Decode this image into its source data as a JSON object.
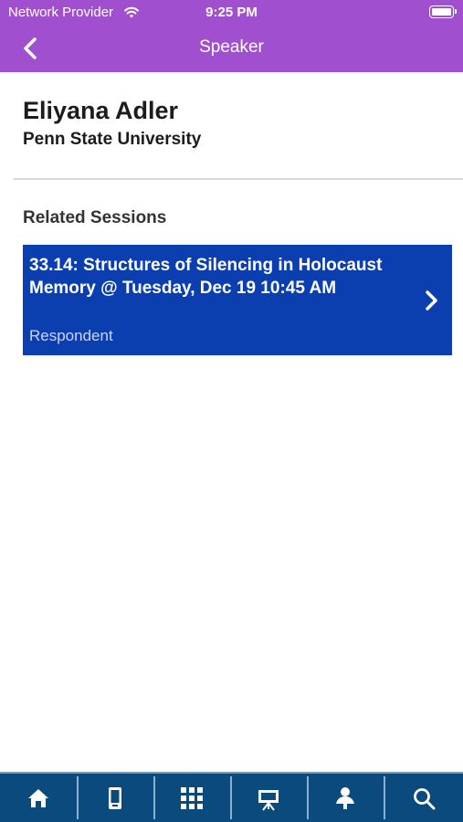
{
  "status_bar": {
    "carrier": "Network Provider",
    "time": "9:25 PM"
  },
  "header": {
    "title": "Speaker",
    "back_icon": "chevron-left-icon",
    "background": "#a050cf"
  },
  "speaker": {
    "name": "Eliyana Adler",
    "organization": "Penn State University"
  },
  "related": {
    "heading": "Related Sessions",
    "sessions": [
      {
        "title": "33.14: Structures of Silencing in Holocaust Memory @ Tuesday, Dec 19 10:45 AM",
        "role": "Respondent",
        "background": "#0b3fb0"
      }
    ]
  },
  "tab_bar": {
    "background": "#0b4a7c",
    "tabs": [
      {
        "icon": "home-icon"
      },
      {
        "icon": "mobile-device-icon"
      },
      {
        "icon": "grid-icon"
      },
      {
        "icon": "presentation-easel-icon"
      },
      {
        "icon": "speaker-person-icon"
      },
      {
        "icon": "search-icon"
      }
    ]
  }
}
